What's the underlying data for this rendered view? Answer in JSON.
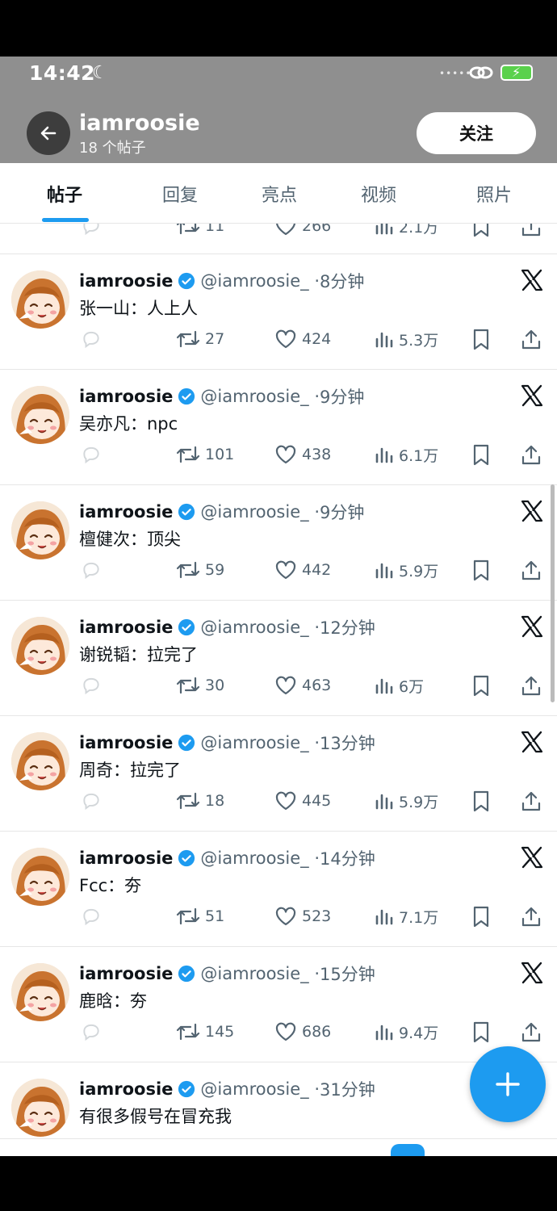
{
  "status_bar": {
    "time": "14:42"
  },
  "header": {
    "profile_name": "iamroosie",
    "post_count": "18 个帖子",
    "follow_label": "关注"
  },
  "tabs": [
    {
      "label": "帖子",
      "active": true
    },
    {
      "label": "回复",
      "active": false
    },
    {
      "label": "亮点",
      "active": false
    },
    {
      "label": "视频",
      "active": false
    },
    {
      "label": "照片",
      "active": false
    }
  ],
  "partial_row": {
    "retweets": "11",
    "likes": "266",
    "views": "2.1万"
  },
  "tweets": [
    {
      "name": "iamroosie",
      "handle": "@iamroosie_",
      "time": "8分钟",
      "text": "张一山：人上人",
      "retweets": "27",
      "likes": "424",
      "views": "5.3万"
    },
    {
      "name": "iamroosie",
      "handle": "@iamroosie_",
      "time": "9分钟",
      "text": "吴亦凡：npc",
      "retweets": "101",
      "likes": "438",
      "views": "6.1万"
    },
    {
      "name": "iamroosie",
      "handle": "@iamroosie_",
      "time": "9分钟",
      "text": "檀健次：顶尖",
      "retweets": "59",
      "likes": "442",
      "views": "5.9万"
    },
    {
      "name": "iamroosie",
      "handle": "@iamroosie_",
      "time": "12分钟",
      "text": "谢锐韬：拉完了",
      "retweets": "30",
      "likes": "463",
      "views": "6万"
    },
    {
      "name": "iamroosie",
      "handle": "@iamroosie_",
      "time": "13分钟",
      "text": "周奇：拉完了",
      "retweets": "18",
      "likes": "445",
      "views": "5.9万"
    },
    {
      "name": "iamroosie",
      "handle": "@iamroosie_",
      "time": "14分钟",
      "text": "Fcc：夯",
      "retweets": "51",
      "likes": "523",
      "views": "7.1万"
    },
    {
      "name": "iamroosie",
      "handle": "@iamroosie_",
      "time": "15分钟",
      "text": "鹿晗：夯",
      "retweets": "145",
      "likes": "686",
      "views": "9.4万"
    },
    {
      "name": "iamroosie",
      "handle": "@iamroosie_",
      "time": "31分钟",
      "text": "有很多假号在冒充我"
    }
  ],
  "colors": {
    "accent": "#1d9bf0",
    "header_bg": "#8f8f8f",
    "text": "#0f1419",
    "muted": "#536471"
  }
}
